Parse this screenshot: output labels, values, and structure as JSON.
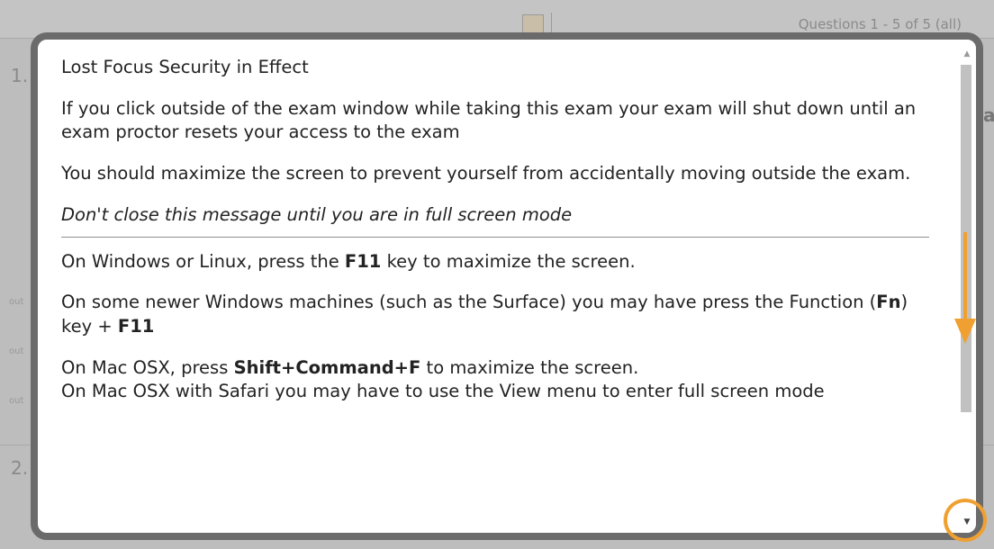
{
  "background": {
    "counter_text": "Questions 1 - 5 of 5 (all)",
    "question_numbers": [
      "1.",
      "2."
    ],
    "side_fragments": [
      "out",
      "out",
      "out"
    ],
    "right_fragment": "al"
  },
  "modal": {
    "title": "Lost Focus Security in Effect",
    "intro": "If you click outside of the exam window while taking this exam your exam will shut down until an exam proctor resets your access to the exam",
    "maximize_advice": "You should maximize the screen to prevent yourself from accidentally moving outside the exam.",
    "warning": "Don't close this message until you are in full screen mode",
    "windows_instruction": {
      "before": "On Windows or Linux, press the ",
      "key": "F11",
      "after": " key to maximize the screen."
    },
    "surface_instruction": {
      "before": "On some newer Windows machines (such as the Surface) you may have press the Function (",
      "fn_key": "Fn",
      "middle": ") key + ",
      "key": "F11"
    },
    "mac_instruction": {
      "before": "On Mac OSX, press ",
      "key": "Shift+Command+F",
      "after": " to maximize the screen."
    },
    "safari_instruction": "On Mac OSX with Safari you may have to use the View menu to enter full screen mode"
  },
  "scrollbar": {
    "up_icon": "▲",
    "down_icon": "▼"
  },
  "annotations": {
    "color": "#f0a030"
  }
}
